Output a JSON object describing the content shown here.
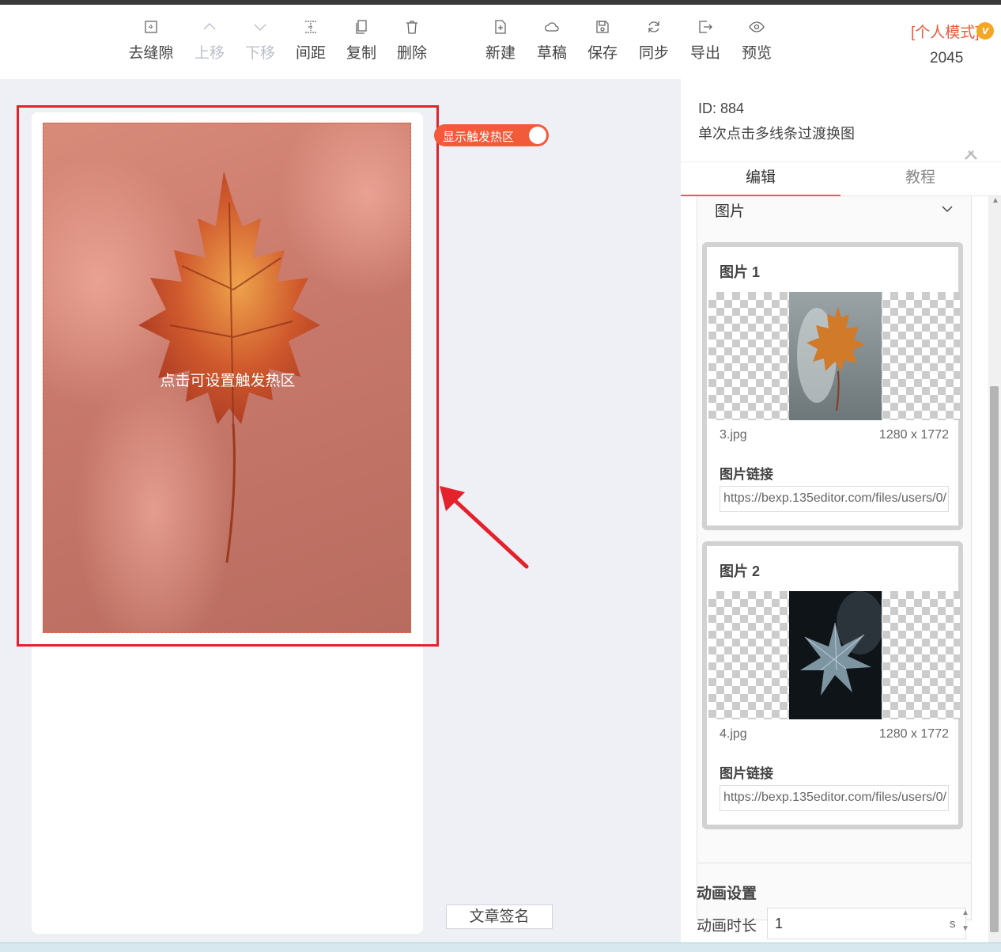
{
  "toolbar": {
    "items": [
      {
        "label": "去缝隙",
        "icon": "grid-icon",
        "disabled": false
      },
      {
        "label": "上移",
        "icon": "chevron-up-icon",
        "disabled": true
      },
      {
        "label": "下移",
        "icon": "chevron-down-icon",
        "disabled": true
      },
      {
        "label": "间距",
        "icon": "spacing-icon",
        "disabled": false
      },
      {
        "label": "复制",
        "icon": "copy-icon",
        "disabled": false
      },
      {
        "label": "删除",
        "icon": "trash-icon",
        "disabled": false
      },
      {
        "label": "新建",
        "icon": "new-file-icon",
        "disabled": false
      },
      {
        "label": "草稿",
        "icon": "cloud-icon",
        "disabled": false
      },
      {
        "label": "保存",
        "icon": "save-icon",
        "disabled": false
      },
      {
        "label": "同步",
        "icon": "sync-icon",
        "disabled": false
      },
      {
        "label": "导出",
        "icon": "export-icon",
        "disabled": false
      },
      {
        "label": "预览",
        "icon": "eye-icon",
        "disabled": false
      }
    ],
    "mode_label": "[个人模式]",
    "mode_badge": "v",
    "mode_number": "2045"
  },
  "canvas": {
    "hotzone_label": "点击可设置触发热区",
    "toggle_label": "显示触发热区",
    "toggle_on": true,
    "sign_button": "文章签名"
  },
  "panel": {
    "id_text": "ID: 884",
    "name": "单次点击多线条过渡换图",
    "tabs": [
      {
        "label": "编辑",
        "active": true
      },
      {
        "label": "教程",
        "active": false
      }
    ],
    "section_title": "图片",
    "images": [
      {
        "title": "图片 1",
        "file": "3.jpg",
        "size": "1280 x 1772",
        "link_label": "图片链接",
        "link": "https://bexp.135editor.com/files/users/0/"
      },
      {
        "title": "图片 2",
        "file": "4.jpg",
        "size": "1280 x 1772",
        "link_label": "图片链接",
        "link": "https://bexp.135editor.com/files/users/0/"
      }
    ],
    "animation": {
      "heading": "动画设置",
      "duration_label": "动画时长",
      "duration_value": "1",
      "unit": "s"
    }
  },
  "colors": {
    "accent": "#f25a3a",
    "highlight_frame": "#e3222c",
    "mode_text": "#ee5a3a",
    "badge": "#f5a623"
  }
}
